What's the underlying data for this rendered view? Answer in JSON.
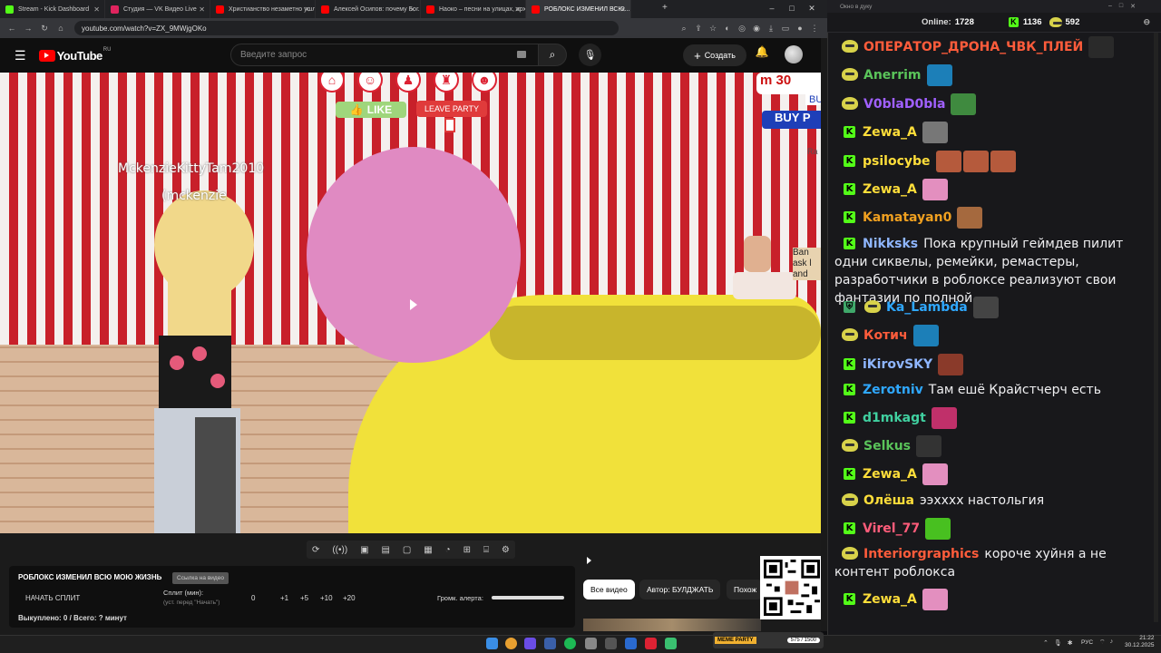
{
  "browser": {
    "tabs": [
      {
        "label": "Stream - Kick Dashboard",
        "color": "#53fc18"
      },
      {
        "label": "Студия — VK Видео Live",
        "color": "#e0245e"
      },
      {
        "label": "Христианство незаметно ушло...",
        "color": "#ff0000"
      },
      {
        "label": "Алексей Осипов: почему Бог...",
        "color": "#ff0000"
      },
      {
        "label": "Наоко – песни на улицах, арх...",
        "color": "#ff0000"
      },
      {
        "label": "РОБЛОКС ИЗМЕНИЛ ВСЮ...",
        "color": "#ff0000"
      }
    ],
    "url": "youtube.com/watch?v=ZX_9MWjgOKo"
  },
  "youtube": {
    "logo_text": "YouTube",
    "region": "RU",
    "search_placeholder": "Введите запрос",
    "create_label": "Создать"
  },
  "video": {
    "player_name": "MckenzieKittyTam2010",
    "player_handle": "(mckenzie",
    "like_label": "LIKE",
    "leave_label": "LEAVE PARTY",
    "buy_label": "BUY P",
    "coins_label": "m 30",
    "bu_label": "BU",
    "ra_label": "Ra",
    "side_sign": "Ban\nask l\nand"
  },
  "info": {
    "title": "РОБЛОКС ИЗМЕНИЛ ВСЮ МОЮ ЖИЗНЬ",
    "badge": "Ссылка на видео",
    "start_split": "НАЧАТЬ СПЛИТ",
    "split_label": "Сплит (мин):",
    "split_hint": "(уст. перед \"Начать\")",
    "split_values": [
      "0",
      "+1",
      "+5",
      "+10",
      "+20"
    ],
    "volume_label": "Громк. алерта:",
    "status": "Выкуплено: 0 / Всего: ? минут",
    "volume_level": 1.0
  },
  "recommend": {
    "pills": [
      "Все видео",
      "Автор: БУЛДЖАТЬ",
      "Похож"
    ]
  },
  "chat": {
    "window_title": "Окно в дуку",
    "online_label": "Online:",
    "online_count": "1728",
    "kick_count": "1136",
    "other_count": "592",
    "messages": [
      {
        "badge": "h",
        "user": "ОПЕРАТОР_ДРОНА_ЧВК_ПЛЕЙ",
        "color": "#ff5c3b",
        "text": "",
        "emote": "#2a2a2a",
        "emotes": 1
      },
      {
        "badge": "h",
        "user": "Anerrim",
        "color": "#5ac45a",
        "text": "",
        "emote": "#1c7fb8",
        "emotes": 1
      },
      {
        "badge": "h",
        "user": "V0blaD0bla",
        "color": "#a060ff",
        "text": "",
        "emote": "#3f8a3f",
        "emotes": 1
      },
      {
        "badge": "k",
        "user": "Zewa_A",
        "color": "#ffde3a",
        "text": "",
        "emote": "#777",
        "emotes": 1
      },
      {
        "badge": "k",
        "user": "psilocybe",
        "color": "#ffde3a",
        "text": "",
        "emote": "#b55a3c",
        "emotes": 3
      },
      {
        "badge": "k",
        "user": "Zewa_A",
        "color": "#ffde3a",
        "text": "",
        "emote": "#e38fbf",
        "emotes": 1
      },
      {
        "badge": "k",
        "user": "Kamatayan0",
        "color": "#f0a020",
        "text": "",
        "emote": "#a5693e",
        "emotes": 1
      },
      {
        "badge": "k",
        "user": "Nikksks",
        "color": "#8fb6ff",
        "text": "Пока крупный геймдев пилит одни сиквелы, ремейки, ремастеры, разработчики в роблоксе реализуют свои фантазии по полной",
        "emote": "",
        "emotes": 0
      },
      {
        "badge": "s",
        "user": "Ka_Lambda",
        "color": "#2fa8ff",
        "text": "",
        "emote": "#444",
        "emotes": 1
      },
      {
        "badge": "h",
        "user": "Котич",
        "color": "#ff5c3b",
        "text": "",
        "emote": "#1c7fb8",
        "emotes": 1
      },
      {
        "badge": "k",
        "user": "iKirovSKY",
        "color": "#8fb6ff",
        "text": "",
        "emote": "#8a3a2a",
        "emotes": 1
      },
      {
        "badge": "k",
        "user": "Zerotniv",
        "color": "#2fa8ff",
        "text": "Там ешё Крайстчерч есть",
        "emote": "",
        "emotes": 0
      },
      {
        "badge": "k",
        "user": "d1mkagt",
        "color": "#40d0a0",
        "text": "",
        "emote": "#c0306a",
        "emotes": 1
      },
      {
        "badge": "h",
        "user": "Selkus",
        "color": "#5ac45a",
        "text": "",
        "emote": "#333",
        "emotes": 1
      },
      {
        "badge": "k",
        "user": "Zewa_A",
        "color": "#ffde3a",
        "text": "",
        "emote": "#e38fbf",
        "emotes": 1
      },
      {
        "badge": "h",
        "user": "Олёша",
        "color": "#ffde3a",
        "text": "ээхххх настольгия",
        "emote": "",
        "emotes": 0
      },
      {
        "badge": "k",
        "user": "Virel_77",
        "color": "#ff5c7a",
        "text": "",
        "emote": "#48c020",
        "emotes": 1
      },
      {
        "badge": "h",
        "user": "Interiorgraphics",
        "color": "#ff5c3b",
        "text": "короче хуйня а не контент роблокса",
        "emote": "",
        "emotes": 0
      },
      {
        "badge": "k",
        "user": "Zewa_A",
        "color": "#ffde3a",
        "text": "",
        "emote": "#e38fbf",
        "emotes": 1
      }
    ]
  },
  "taskbar": {
    "lang": "РУС",
    "time": "21:22",
    "date": "30.12.2025",
    "widget_text": "MEME PARTY",
    "widget_count": "575 / 1500"
  }
}
